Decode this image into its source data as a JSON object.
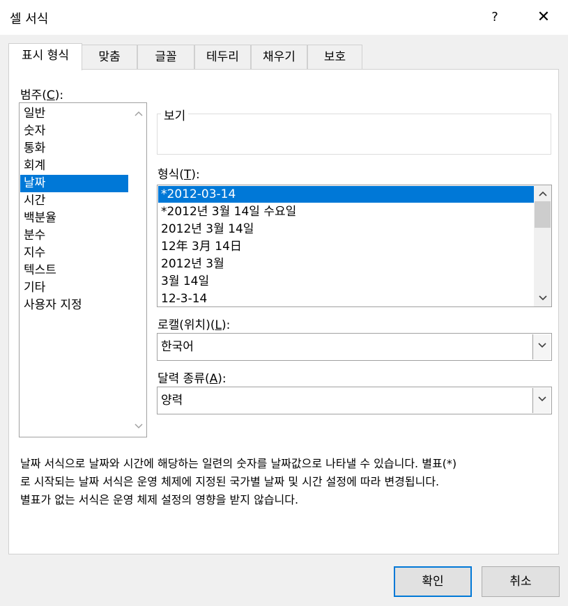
{
  "window": {
    "title": "셀 서식",
    "help_label": "?",
    "close_label": "✕"
  },
  "tabs": [
    {
      "label": "표시 형식",
      "active": true
    },
    {
      "label": "맞춤",
      "active": false
    },
    {
      "label": "글꼴",
      "active": false
    },
    {
      "label": "테두리",
      "active": false
    },
    {
      "label": "채우기",
      "active": false
    },
    {
      "label": "보호",
      "active": false
    }
  ],
  "category": {
    "label": "범주(",
    "accel": "C",
    "label_end": "):",
    "items": [
      "일반",
      "숫자",
      "통화",
      "회계",
      "날짜",
      "시간",
      "백분율",
      "분수",
      "지수",
      "텍스트",
      "기타",
      "사용자 지정"
    ],
    "selected_index": 4
  },
  "preview": {
    "label": "보기",
    "value": ""
  },
  "format": {
    "label": "형식(",
    "accel": "T",
    "label_end": "):",
    "items": [
      "*2012-03-14",
      "*2012년 3월 14일 수요일",
      "2012년 3월 14일",
      "12年 3月 14日",
      "2012년 3월",
      "3월 14일",
      "12-3-14"
    ],
    "selected_index": 0
  },
  "locale": {
    "label": "로캘(위치)(",
    "accel": "L",
    "label_end": "):",
    "value": "한국어"
  },
  "calendar": {
    "label": "달력 종류(",
    "accel": "A",
    "label_end": "):",
    "value": "양력"
  },
  "description": [
    "날짜 서식으로 날짜와 시간에 해당하는 일련의 숫자를 날짜값으로 나타낼 수 있습니다. 별표(*)",
    "로 시작되는 날짜 서식은 운영 체제에 지정된 국가별 날짜 및 시간 설정에 따라 변경됩니다.",
    "별표가 없는 서식은 운영 체제 설정의 영향을 받지 않습니다."
  ],
  "buttons": {
    "ok": "확인",
    "cancel": "취소"
  },
  "colors": {
    "selection": "#0078d7",
    "dialog_bg": "#f0f0f0",
    "panel_bg": "#ffffff"
  },
  "icons": {
    "scroll_up": "chevron-up-icon",
    "scroll_down": "chevron-down-icon",
    "dropdown": "chevron-down-icon"
  }
}
